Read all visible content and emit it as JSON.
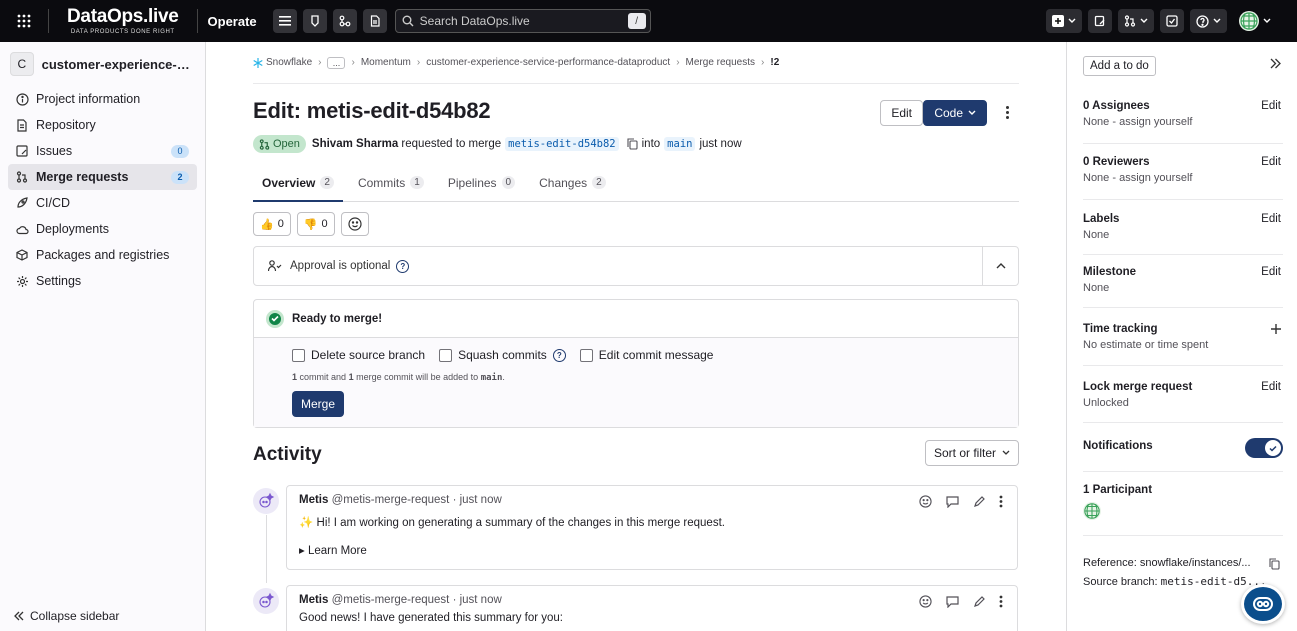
{
  "topbar": {
    "brand": "DataOps.live",
    "tagline": "DATA PRODUCTS DONE RIGHT",
    "section": "Operate",
    "search_placeholder": "Search DataOps.live",
    "search_shortcut": "/"
  },
  "sidebar": {
    "project_initial": "C",
    "project_name": "customer-experience-service-performance-dataproduct",
    "items": [
      {
        "label": "Project information",
        "icon": "info-icon"
      },
      {
        "label": "Repository",
        "icon": "doc-icon"
      },
      {
        "label": "Issues",
        "icon": "issues-icon",
        "badge": "0"
      },
      {
        "label": "Merge requests",
        "icon": "merge-icon",
        "badge": "2",
        "active": true
      },
      {
        "label": "CI/CD",
        "icon": "rocket-icon"
      },
      {
        "label": "Deployments",
        "icon": "cloud-icon"
      },
      {
        "label": "Packages and registries",
        "icon": "package-icon"
      },
      {
        "label": "Settings",
        "icon": "gear-icon"
      }
    ],
    "collapse_label": "Collapse sidebar"
  },
  "breadcrumb": {
    "items": [
      "Snowflake",
      "...",
      "Momentum",
      "customer-experience-service-performance-dataproduct",
      "Merge requests",
      "!2"
    ]
  },
  "mr": {
    "title": "Edit: metis-edit-d54b82",
    "edit_label": "Edit",
    "code_label": "Code",
    "status": "Open",
    "author": "Shivam Sharma",
    "requested_text": "requested to merge",
    "source_branch": "metis-edit-d54b82",
    "into_text": "into",
    "target_branch": "main",
    "time": "just now"
  },
  "tabs": [
    {
      "label": "Overview",
      "count": "2"
    },
    {
      "label": "Commits",
      "count": "1"
    },
    {
      "label": "Pipelines",
      "count": "0"
    },
    {
      "label": "Changes",
      "count": "2"
    }
  ],
  "reactions": {
    "thumbs_up": "0",
    "thumbs_down": "0"
  },
  "approval": {
    "text": "Approval is optional"
  },
  "merge": {
    "title": "Ready to merge!",
    "option_delete": "Delete source branch",
    "option_squash": "Squash commits",
    "option_edit_msg": "Edit commit message",
    "note_count1": "1",
    "note_text1": "commit and",
    "note_count2": "1",
    "note_text2": "merge commit will be added to",
    "note_branch": "main",
    "note_end": ".",
    "button": "Merge"
  },
  "activity": {
    "title": "Activity",
    "sort_label": "Sort or filter",
    "notes": [
      {
        "author": "Metis",
        "handle": "@metis-merge-request · just now",
        "body": "✨ Hi! I am working on generating a summary of the changes in this merge request.",
        "more": "Learn More"
      },
      {
        "author": "Metis",
        "handle": "@metis-merge-request · just now",
        "body": "Good news! I have generated this summary for you:"
      }
    ]
  },
  "right_sidebar": {
    "todo_label": "Add a to do",
    "assignees_label": "0 Assignees",
    "assignees_value": "None - assign yourself",
    "reviewers_label": "0 Reviewers",
    "reviewers_value": "None - assign yourself",
    "labels_label": "Labels",
    "labels_value": "None",
    "milestone_label": "Milestone",
    "milestone_value": "None",
    "time_label": "Time tracking",
    "time_value": "No estimate or time spent",
    "lock_label": "Lock merge request",
    "lock_value": "Unlocked",
    "notifications_label": "Notifications",
    "notifications_on": true,
    "participants_label": "1 Participant",
    "edit_label": "Edit",
    "reference_label": "Reference:",
    "reference_value": "snowflake/instances/...",
    "source_label": "Source branch:",
    "source_value": "metis-edit-d5..."
  },
  "colors": {
    "accent": "#1f3a6e",
    "success": "#108548",
    "topbar": "#0b0b0f"
  }
}
